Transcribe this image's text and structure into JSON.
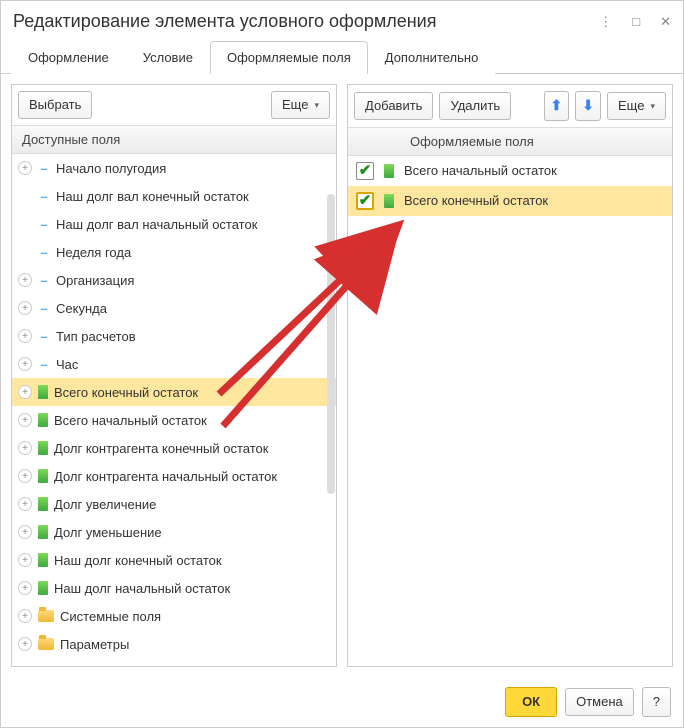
{
  "window": {
    "title": "Редактирование элемента условного оформления"
  },
  "tabs": [
    {
      "label": "Оформление"
    },
    {
      "label": "Условие"
    },
    {
      "label": "Оформляемые поля",
      "active": true
    },
    {
      "label": "Дополнительно"
    }
  ],
  "left": {
    "select_btn": "Выбрать",
    "more_btn": "Еще",
    "header": "Доступные поля",
    "rows": [
      {
        "exp": "plus",
        "icon": "dash",
        "label": "Начало полугодия"
      },
      {
        "exp": "none",
        "icon": "dash",
        "label": "Наш долг вал конечный остаток"
      },
      {
        "exp": "none",
        "icon": "dash",
        "label": "Наш долг вал начальный остаток"
      },
      {
        "exp": "none",
        "icon": "dash",
        "label": "Неделя года"
      },
      {
        "exp": "plus",
        "icon": "dash",
        "label": "Организация"
      },
      {
        "exp": "plus",
        "icon": "dash",
        "label": "Секунда"
      },
      {
        "exp": "plus",
        "icon": "dash",
        "label": "Тип расчетов"
      },
      {
        "exp": "plus",
        "icon": "dash",
        "label": "Час"
      },
      {
        "exp": "plus",
        "icon": "green",
        "label": "Всего конечный остаток",
        "selected": true
      },
      {
        "exp": "plus",
        "icon": "green",
        "label": "Всего начальный остаток"
      },
      {
        "exp": "plus",
        "icon": "green",
        "label": "Долг контрагента конечный остаток"
      },
      {
        "exp": "plus",
        "icon": "green",
        "label": "Долг контрагента начальный остаток"
      },
      {
        "exp": "plus",
        "icon": "green",
        "label": "Долг увеличение"
      },
      {
        "exp": "plus",
        "icon": "green",
        "label": "Долг уменьшение"
      },
      {
        "exp": "plus",
        "icon": "green",
        "label": "Наш долг конечный остаток"
      },
      {
        "exp": "plus",
        "icon": "green",
        "label": "Наш долг начальный остаток"
      },
      {
        "exp": "plus",
        "icon": "folder",
        "label": "Системные поля"
      },
      {
        "exp": "plus",
        "icon": "folder",
        "label": "Параметры"
      }
    ]
  },
  "right": {
    "add_btn": "Добавить",
    "delete_btn": "Удалить",
    "more_btn": "Еще",
    "header": "Оформляемые поля",
    "rows": [
      {
        "checked": true,
        "label": "Всего начальный остаток"
      },
      {
        "checked": true,
        "label": "Всего конечный остаток",
        "selected": true
      }
    ]
  },
  "footer": {
    "ok": "ОК",
    "cancel": "Отмена",
    "help": "?"
  }
}
